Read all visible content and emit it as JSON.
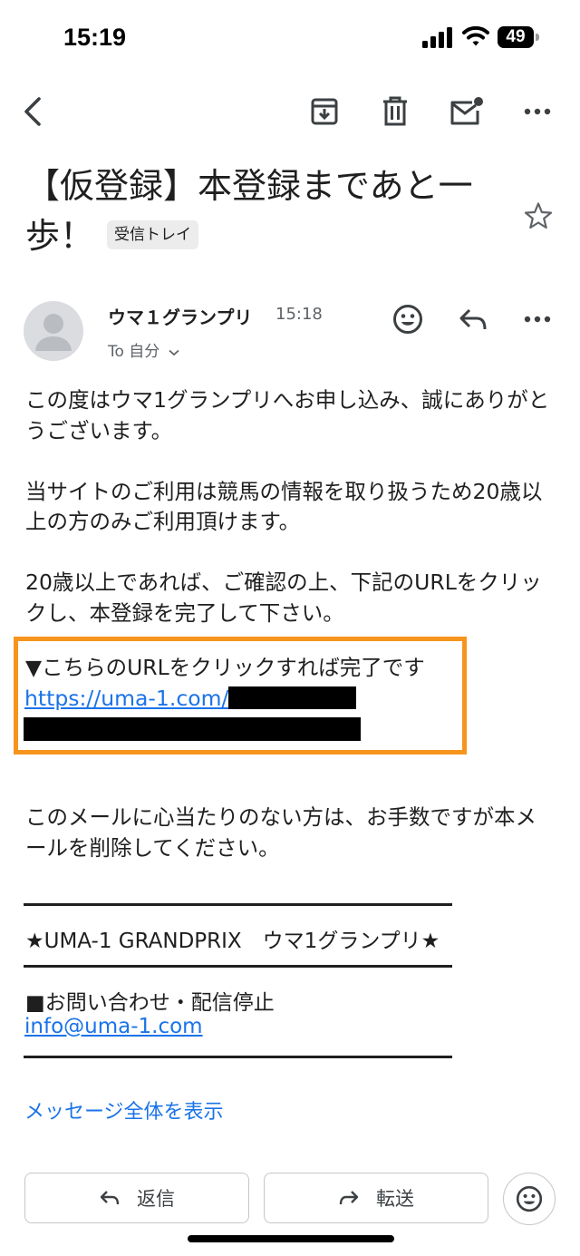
{
  "status_bar": {
    "time": "15:19",
    "battery": "49"
  },
  "email": {
    "subject": "【仮登録】本登録まであと一歩！",
    "label": "受信トレイ",
    "sender": "ウマ１グランプリ",
    "time": "15:18",
    "to": "To 自分"
  },
  "body": {
    "p1": "この度はウマ1グランプリへお申し込み、誠にありがとうございます。",
    "p2": "当サイトのご利用は競馬の情報を取り扱うため20歳以上の方のみご利用頂けます。",
    "p3": "20歳以上であれば、ご確認の上、下記のURLをクリックし、本登録を完了して下さい。",
    "url_intro": "▼こちらのURLをクリックすれば完了です",
    "url": "https://uma-1.com/",
    "p4": "このメールに心当たりのない方は、お手数ですが本メールを削除してください。",
    "signature": "★UMA-1 GRANDPRIX　ウマ1グランプリ★",
    "contact_label": "■お問い合わせ・配信停止",
    "contact_email": "info@uma-1.com"
  },
  "show_full_message": "メッセージ全体を表示",
  "actions": {
    "reply": "返信",
    "forward": "転送"
  }
}
